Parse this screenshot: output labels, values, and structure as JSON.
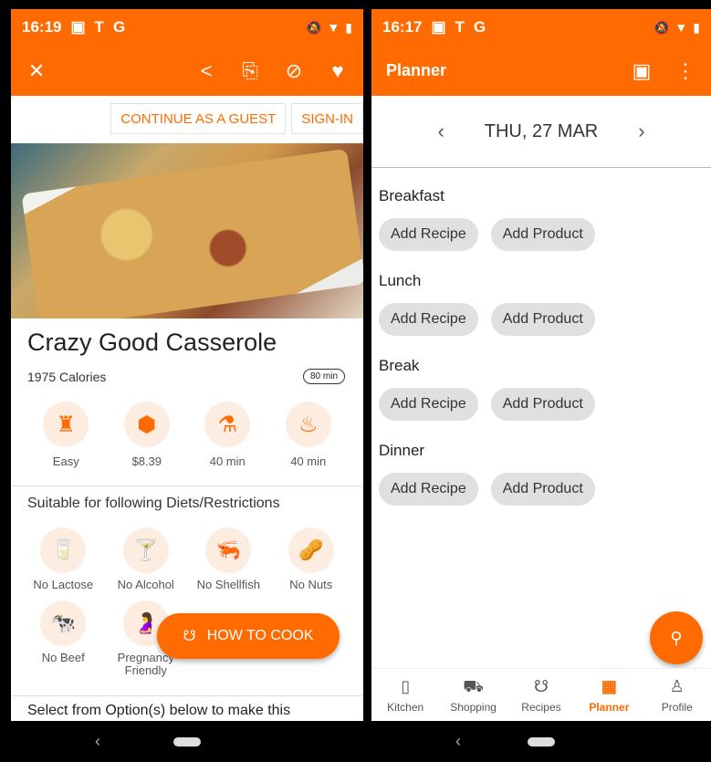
{
  "left": {
    "status": {
      "time": "16:19",
      "icons": [
        "▣",
        "T",
        "G"
      ]
    },
    "actions": {
      "close": "✕",
      "share": "<",
      "add_planner": "⎘",
      "block": "⊘",
      "favorite": "♥"
    },
    "guest": {
      "continue_label": "CONTINUE AS A GUEST",
      "signin_label": "SIGN-IN"
    },
    "recipe": {
      "title": "Crazy Good Casserole",
      "calories": "1975 Calories",
      "time_badge": "80 min"
    },
    "stats": [
      {
        "label": "Easy",
        "icon": "chef-hat-icon",
        "glyph": "♜"
      },
      {
        "label": "$8.39",
        "icon": "price-tag-icon",
        "glyph": "⬢"
      },
      {
        "label": "40 min",
        "icon": "mortar-icon",
        "glyph": "⚗"
      },
      {
        "label": "40 min",
        "icon": "cooking-pot-icon",
        "glyph": "♨"
      }
    ],
    "diets": {
      "title": "Suitable for following Diets/Restrictions",
      "items": [
        {
          "label": "No Lactose",
          "glyph": "🥛"
        },
        {
          "label": "No Alcohol",
          "glyph": "🍸"
        },
        {
          "label": "No Shellfish",
          "glyph": "🦐"
        },
        {
          "label": "No Nuts",
          "glyph": "🥜"
        },
        {
          "label": "No Beef",
          "glyph": "🐄"
        },
        {
          "label": "Pregnancy Friendly",
          "glyph": "🤰"
        }
      ]
    },
    "cook_button": {
      "label": "HOW TO COOK",
      "icon": "chef-hat-icon"
    },
    "select_text": "Select from Option(s) below to make this"
  },
  "right": {
    "status": {
      "time": "16:17",
      "icons": [
        "▣",
        "T",
        "G"
      ]
    },
    "title": "Planner",
    "date": {
      "label": "THU, 27 MAR",
      "prev": "‹",
      "next": "›"
    },
    "meals": [
      {
        "title": "Breakfast",
        "recipe": "Add Recipe",
        "product": "Add Product"
      },
      {
        "title": "Lunch",
        "recipe": "Add Recipe",
        "product": "Add Product"
      },
      {
        "title": "Break",
        "recipe": "Add Recipe",
        "product": "Add Product"
      },
      {
        "title": "Dinner",
        "recipe": "Add Recipe",
        "product": "Add Product"
      }
    ],
    "nav": [
      {
        "label": "Kitchen",
        "icon": "fridge-icon",
        "glyph": "▯",
        "active": false
      },
      {
        "label": "Shopping",
        "icon": "cart-icon",
        "glyph": "⛟",
        "active": false
      },
      {
        "label": "Recipes",
        "icon": "chef-hat-icon",
        "glyph": "☋",
        "active": false
      },
      {
        "label": "Planner",
        "icon": "calendar-icon",
        "glyph": "▦",
        "active": true
      },
      {
        "label": "Profile",
        "icon": "person-icon",
        "glyph": "♙",
        "active": false
      }
    ]
  }
}
